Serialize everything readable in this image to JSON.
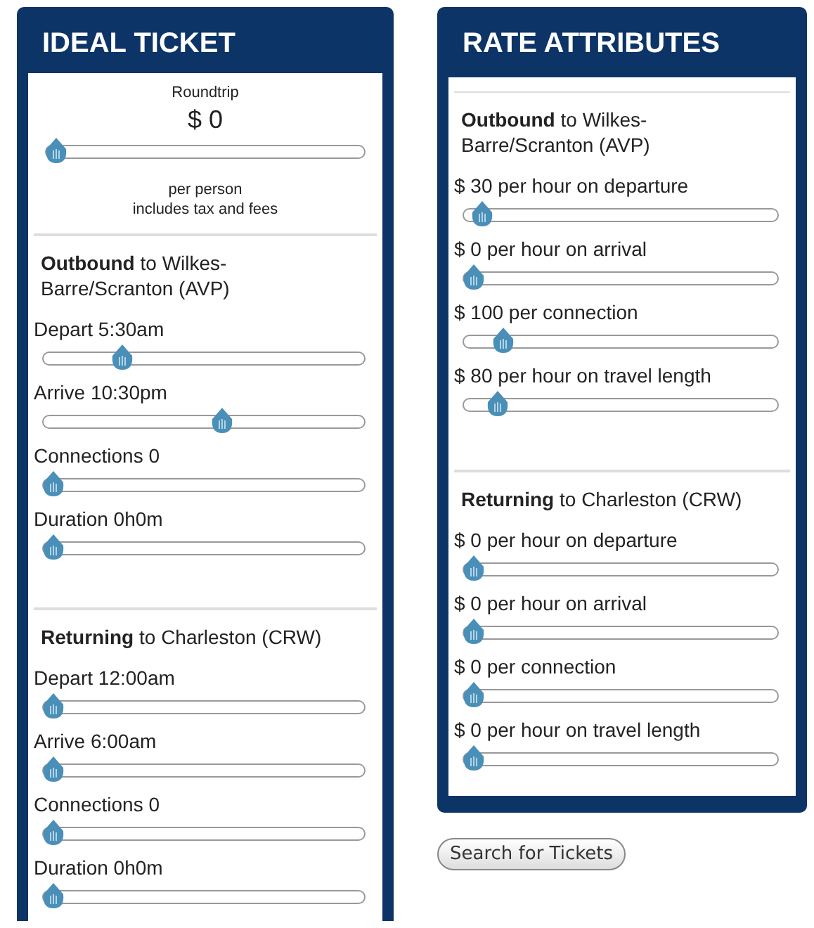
{
  "ideal_ticket": {
    "title": "IDEAL TICKET",
    "price": {
      "label": "Roundtrip",
      "value": "$ 0",
      "level": 0,
      "notes": [
        "per person",
        "includes tax and fees"
      ]
    },
    "sections": [
      {
        "heading": "**Outbound** to Wilkes-Barre/Scranton (AVP)",
        "sliders": [
          {
            "label": "Depart 5:30am",
            "level": 0.23
          },
          {
            "label": "Arrive 10:30pm",
            "level": 0.56
          },
          {
            "label": "Connections 0",
            "level": 0
          },
          {
            "label": "Duration 0h0m",
            "level": 0
          }
        ]
      },
      {
        "heading": "**Returning** to Charleston (CRW)",
        "sliders": [
          {
            "label": "Depart 12:00am",
            "level": 0
          },
          {
            "label": "Arrive 6:00am",
            "level": 0
          },
          {
            "label": "Connections 0",
            "level": 0
          },
          {
            "label": "Duration 0h0m",
            "level": 0
          }
        ]
      }
    ]
  },
  "rate_attributes": {
    "title": "RATE ATTRIBUTES",
    "sections": [
      {
        "heading": "**Outbound** to Wilkes-Barre/Scranton (AVP)",
        "sliders": [
          {
            "label": "$ 30 per hour on departure",
            "level": 0.03
          },
          {
            "label": "$ 0 per hour on arrival",
            "level": 0
          },
          {
            "label": "$ 100 per connection",
            "level": 0.1
          },
          {
            "label": "$ 80 per hour on travel length",
            "level": 0.08
          }
        ]
      },
      {
        "heading": "**Returning** to Charleston (CRW)",
        "sliders": [
          {
            "label": "$ 0 per hour on departure",
            "level": 0
          },
          {
            "label": "$ 0 per hour on arrival",
            "level": 0
          },
          {
            "label": "$ 0 per connection",
            "level": 0
          },
          {
            "label": "$ 0 per hour on travel length",
            "level": 0
          }
        ]
      }
    ]
  },
  "search_button": "Search for Tickets"
}
